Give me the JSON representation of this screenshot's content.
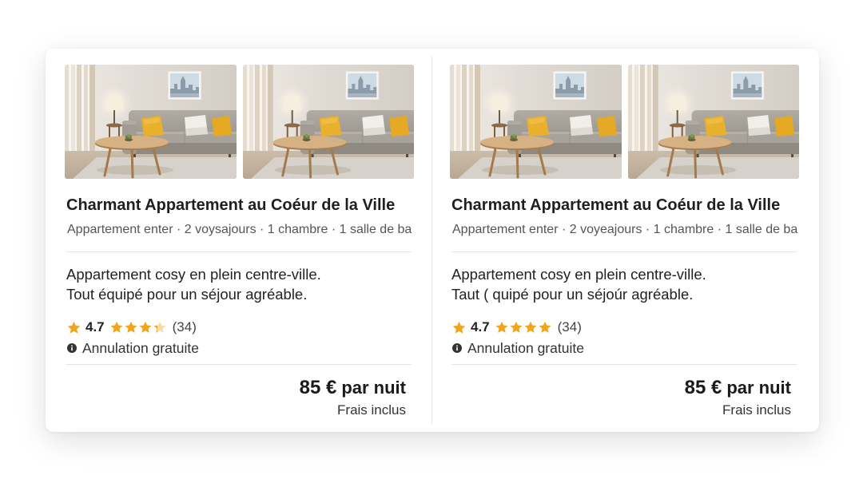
{
  "listings": [
    {
      "title": "Charmant Appartement au Coéur de la Ville",
      "subtitle": "Appartement enter · 2 voysajours · 1 chambre · 1 salle de ba",
      "description": [
        "Appartement cosy en plein centre-ville.",
        "Tout équipé pour un séjour agréable."
      ],
      "rating": "4.7",
      "star_fill": [
        1,
        1,
        1,
        0.35
      ],
      "review_count": "(34)",
      "cancellation": "Annulation gratuite",
      "price": "85 €",
      "price_unit": "par nuit",
      "price_note": "Frais inclus"
    },
    {
      "title": "Charmant Appartement au Coéur de la Ville",
      "subtitle": "Appartement enter · 2 voyeajours · 1 chambre · 1 salle de ba",
      "description": [
        "Appartement cosy en plein centre-ville.",
        "Taut ( quipé pour un séjoúr agréable."
      ],
      "rating": "4.7",
      "star_fill": [
        1,
        1,
        1,
        1
      ],
      "review_count": "(34)",
      "cancellation": "Annulation gratuite",
      "price": "85 €",
      "price_unit": "par nuit",
      "price_note": "Frais inclus"
    }
  ],
  "icons": {
    "rating": "star-icon",
    "cancellation": "info-icon",
    "photos": "living-room-photo"
  },
  "colors": {
    "star": "#f0a51b",
    "star_empty": "#f6deaa",
    "text": "#1f1f1f",
    "muted": "#555555",
    "divider": "#e4e4e4"
  }
}
